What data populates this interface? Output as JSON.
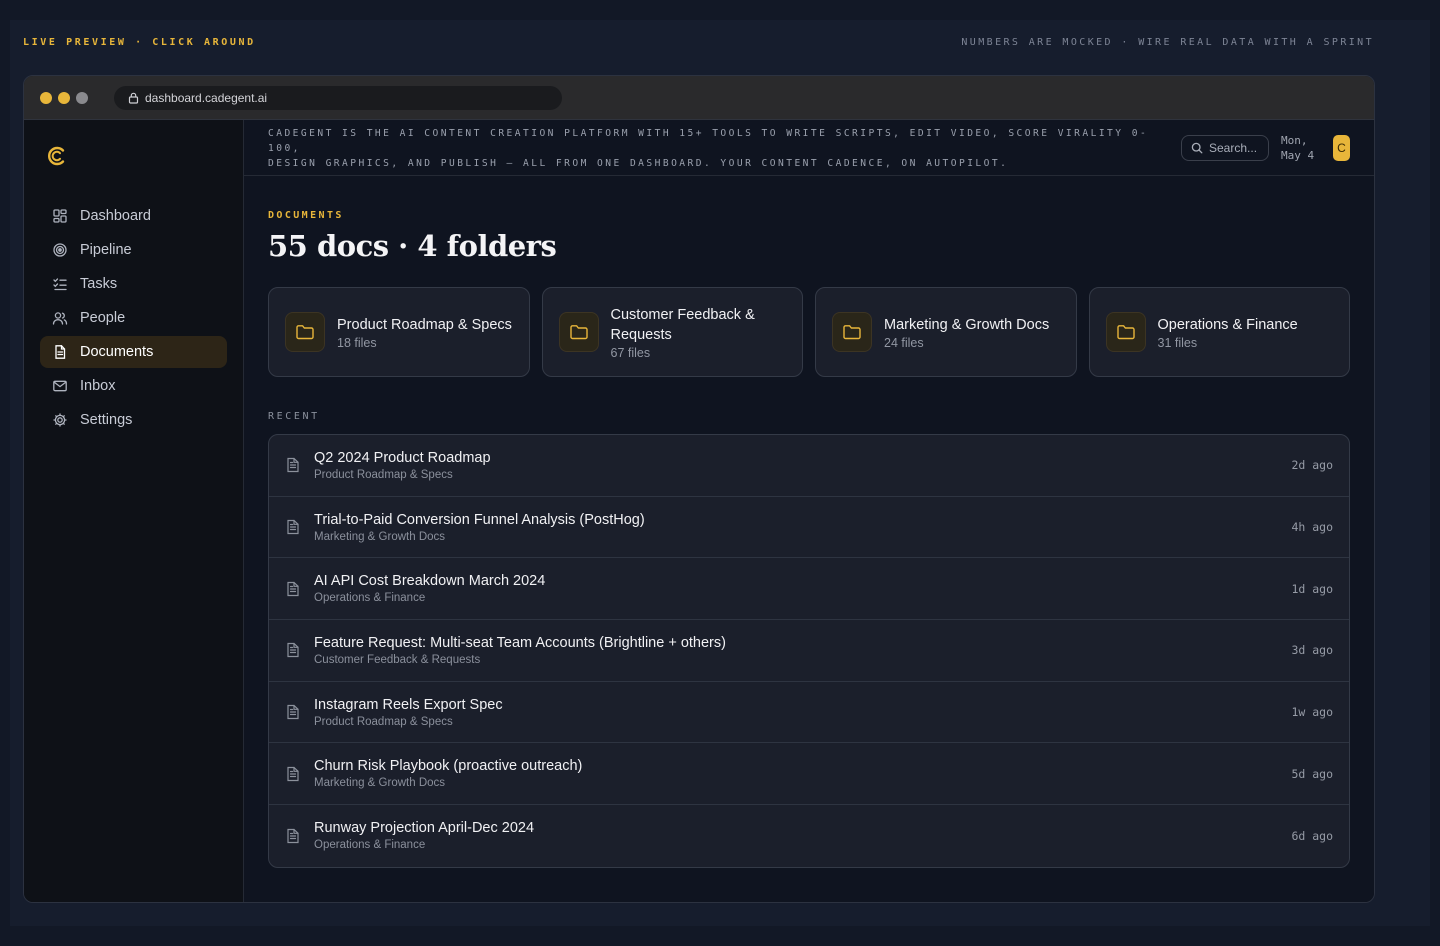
{
  "banner": {
    "left": "LIVE PREVIEW · CLICK AROUND",
    "right": "NUMBERS ARE MOCKED · WIRE REAL DATA WITH A SPRINT"
  },
  "browser": {
    "url": "dashboard.cadegent.ai",
    "dot_colors": [
      "#e8b63a",
      "#e8b63a",
      "#8a8a8e"
    ]
  },
  "colors": {
    "accent": "#e8b63a",
    "background": "#0f1420",
    "sidebar": "#0e1117"
  },
  "sidebar": {
    "logo_icon": "cadegent-c-logo-icon",
    "items": [
      {
        "label": "Dashboard",
        "icon": "grid-icon",
        "active": false
      },
      {
        "label": "Pipeline",
        "icon": "target-icon",
        "active": false
      },
      {
        "label": "Tasks",
        "icon": "checklist-icon",
        "active": false
      },
      {
        "label": "People",
        "icon": "people-icon",
        "active": false
      },
      {
        "label": "Documents",
        "icon": "document-icon",
        "active": true
      },
      {
        "label": "Inbox",
        "icon": "mail-icon",
        "active": false
      },
      {
        "label": "Settings",
        "icon": "gear-icon",
        "active": false
      }
    ]
  },
  "topbar": {
    "tagline_line1": "CADEGENT IS THE AI CONTENT CREATION PLATFORM WITH 15+ TOOLS TO WRITE SCRIPTS, EDIT VIDEO, SCORE VIRALITY 0-100,",
    "tagline_line2": "DESIGN GRAPHICS, AND PUBLISH — ALL FROM ONE DASHBOARD. YOUR CONTENT CADENCE, ON AUTOPILOT.",
    "search_placeholder": "Search...",
    "date_line1": "Mon,",
    "date_line2": "May 4",
    "avatar_initial": "C"
  },
  "page": {
    "eyebrow": "DOCUMENTS",
    "title": "55 docs · 4 folders"
  },
  "folders": [
    {
      "name": "Product Roadmap & Specs",
      "count": "18 files"
    },
    {
      "name": "Customer Feedback & Requests",
      "count": "67 files"
    },
    {
      "name": "Marketing & Growth Docs",
      "count": "24 files"
    },
    {
      "name": "Operations & Finance",
      "count": "31 files"
    }
  ],
  "recent": {
    "label": "RECENT",
    "docs": [
      {
        "title": "Q2 2024 Product Roadmap",
        "folder": "Product Roadmap & Specs",
        "time": "2d ago"
      },
      {
        "title": "Trial-to-Paid Conversion Funnel Analysis (PostHog)",
        "folder": "Marketing & Growth Docs",
        "time": "4h ago"
      },
      {
        "title": "AI API Cost Breakdown March 2024",
        "folder": "Operations & Finance",
        "time": "1d ago"
      },
      {
        "title": "Feature Request: Multi-seat Team Accounts (Brightline + others)",
        "folder": "Customer Feedback & Requests",
        "time": "3d ago"
      },
      {
        "title": "Instagram Reels Export Spec",
        "folder": "Product Roadmap & Specs",
        "time": "1w ago"
      },
      {
        "title": "Churn Risk Playbook (proactive outreach)",
        "folder": "Marketing & Growth Docs",
        "time": "5d ago"
      },
      {
        "title": "Runway Projection April-Dec 2024",
        "folder": "Operations & Finance",
        "time": "6d ago"
      }
    ]
  }
}
